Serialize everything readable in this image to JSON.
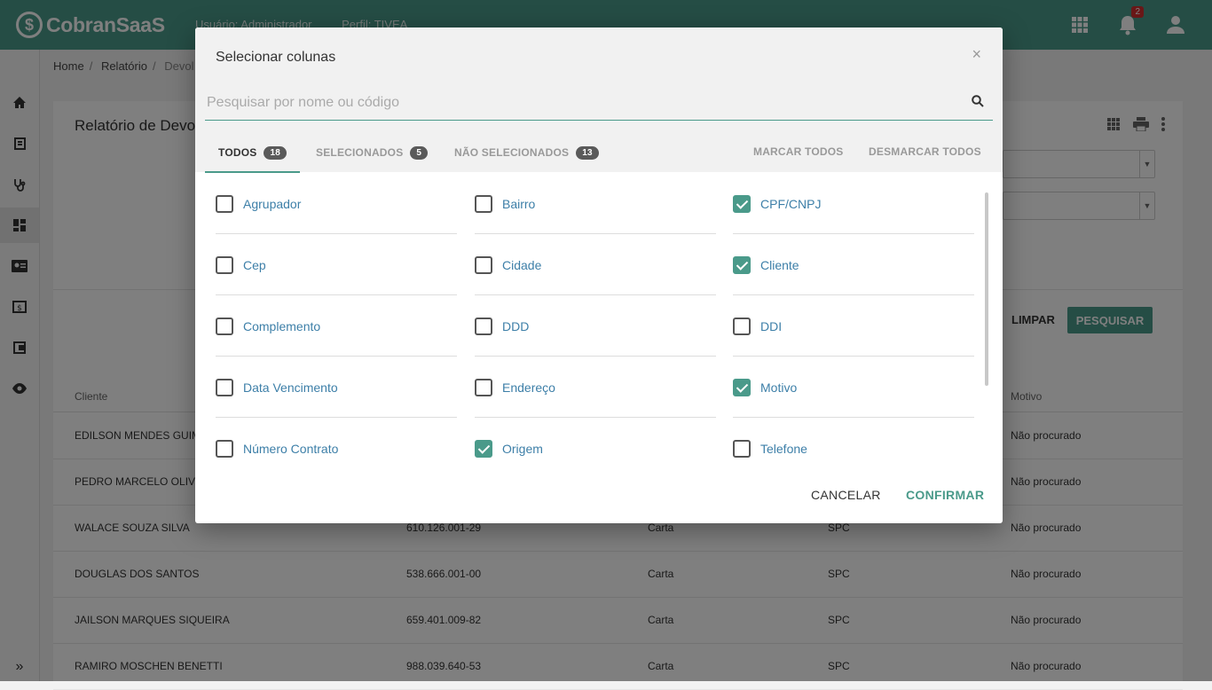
{
  "app": {
    "logo_text": "CobranSaaS",
    "logo_symbol": "$"
  },
  "header": {
    "user_label": "Usuário: Administrador",
    "profile_label": "Perfil: TIVEA",
    "notifications_count": "2",
    "icons": [
      "apps-grid-icon",
      "bell-icon",
      "account-icon"
    ]
  },
  "sidebar": {
    "icons": [
      "home-icon",
      "book-icon",
      "stethoscope-icon",
      "dashboard-icon",
      "contact-card-icon",
      "money-icon",
      "wallet-icon",
      "eye-icon"
    ],
    "expand": "»"
  },
  "breadcrumb": {
    "items": [
      "Home",
      "Relatório",
      "Devol"
    ]
  },
  "page": {
    "title": "Relatório de Devol",
    "limpar_label": "LIMPAR",
    "pesquisar_label": "PESQUISAR"
  },
  "table": {
    "headers": {
      "cliente": "Cliente",
      "motivo": "Motivo"
    },
    "rows": [
      {
        "cliente": "EDILSON MENDES GUIM",
        "cpf": "",
        "tipo": "",
        "origem": "",
        "motivo": "Não procurado"
      },
      {
        "cliente": "PEDRO MARCELO OLIV",
        "cpf": "",
        "tipo": "",
        "origem": "",
        "motivo": "Não procurado"
      },
      {
        "cliente": "WALACE SOUZA SILVA",
        "cpf": "610.126.001-29",
        "tipo": "Carta",
        "origem": "SPC",
        "motivo": "Não procurado"
      },
      {
        "cliente": "DOUGLAS DOS SANTOS",
        "cpf": "538.666.001-00",
        "tipo": "Carta",
        "origem": "SPC",
        "motivo": "Não procurado"
      },
      {
        "cliente": "JAILSON MARQUES SIQUEIRA",
        "cpf": "659.401.009-82",
        "tipo": "Carta",
        "origem": "SPC",
        "motivo": "Não procurado"
      },
      {
        "cliente": "RAMIRO MOSCHEN BENETTI",
        "cpf": "988.039.640-53",
        "tipo": "Carta",
        "origem": "SPC",
        "motivo": "Não procurado"
      }
    ]
  },
  "modal": {
    "title": "Selecionar colunas",
    "close": "×",
    "search_placeholder": "Pesquisar por nome ou código",
    "search_value": "",
    "tabs": [
      {
        "label": "TODOS",
        "count": "18"
      },
      {
        "label": "SELECIONADOS",
        "count": "5"
      },
      {
        "label": "NÃO SELECIONADOS",
        "count": "13"
      }
    ],
    "mark_all": "MARCAR TODOS",
    "unmark_all": "DESMARCAR TODOS",
    "columns": [
      {
        "label": "Agrupador",
        "checked": false
      },
      {
        "label": "Bairro",
        "checked": false
      },
      {
        "label": "CPF/CNPJ",
        "checked": true
      },
      {
        "label": "Cep",
        "checked": false
      },
      {
        "label": "Cidade",
        "checked": false
      },
      {
        "label": "Cliente",
        "checked": true
      },
      {
        "label": "Complemento",
        "checked": false
      },
      {
        "label": "DDD",
        "checked": false
      },
      {
        "label": "DDI",
        "checked": false
      },
      {
        "label": "Data Vencimento",
        "checked": false
      },
      {
        "label": "Endereço",
        "checked": false
      },
      {
        "label": "Motivo",
        "checked": true
      },
      {
        "label": "Número Contrato",
        "checked": false
      },
      {
        "label": "Origem",
        "checked": true
      },
      {
        "label": "Telefone",
        "checked": false
      }
    ],
    "cancel_label": "CANCELAR",
    "confirm_label": "CONFIRMAR"
  },
  "colors": {
    "primary": "#4a9a8a",
    "link": "#3d7fa8",
    "badge": "#d32f2f"
  }
}
